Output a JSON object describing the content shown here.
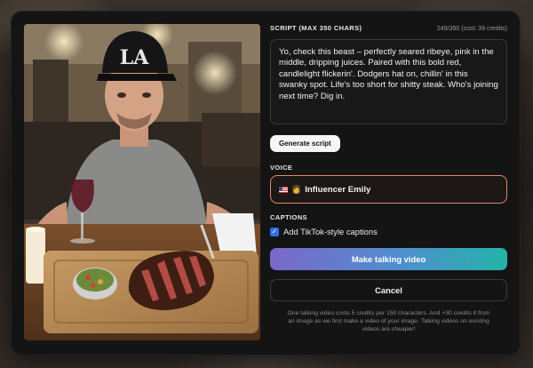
{
  "script": {
    "label": "SCRIPT (MAX 350 CHARS)",
    "count": "249/350 (cost: 39 credits)",
    "text": "Yo, check this beast – perfectly seared ribeye, pink in the middle, dripping juices. Paired with this bold red, candlelight flickerin'. Dodgers hat on, chillin' in this swanky spot. Life's too short for shitty steak. Who's joining next time? Dig in.",
    "generate_label": "Generate script"
  },
  "voice": {
    "label": "VOICE",
    "selected": "Influencer Emily",
    "flag_icon": "us-flag-icon",
    "avatar_icon": "woman-icon"
  },
  "captions": {
    "label": "CAPTIONS",
    "checkbox_label": "Add TikTok-style captions",
    "checked": true
  },
  "actions": {
    "make_label": "Make talking video",
    "cancel_label": "Cancel"
  },
  "footnote": "One talking video costs 5 credits per 150 characters. And +30 credits if from an image as we first make a video of your image. Talking videos on existing videos are cheaper!",
  "colors": {
    "modal_bg": "#141414",
    "voice_border": "#e08a6e",
    "gradient_start": "#7b68c9",
    "gradient_end": "#24b3a6",
    "checkbox": "#2f6fe4"
  }
}
